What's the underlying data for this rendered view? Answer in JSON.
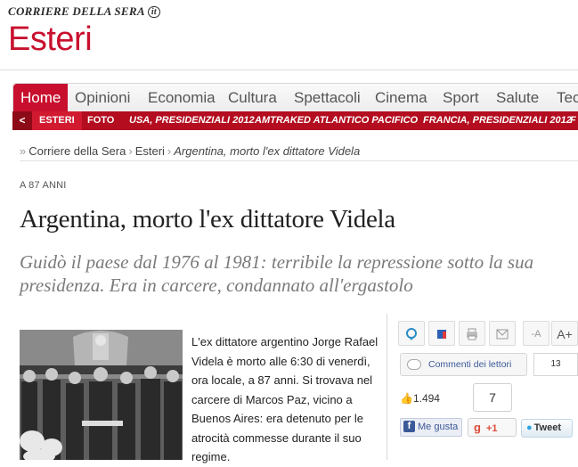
{
  "masthead": {
    "logo_text": "CORRIERE DELLA SERA",
    "logo_mark": "it",
    "section": "Esteri"
  },
  "nav": {
    "items": [
      "Home",
      "Opinioni",
      "Economia",
      "Cultura",
      "Spettacoli",
      "Cinema",
      "Sport",
      "Salute",
      "Tecn"
    ],
    "active": "Home"
  },
  "subnav": {
    "arrow": "<",
    "items": [
      "ESTERI",
      "FOTO",
      "USA, PRESIDENZIALI 2012",
      "AMTRAKED ATLANTICO PACIFICO",
      "FRANCIA, PRESIDENZIALI 2012",
      "F"
    ]
  },
  "breadcrumb": {
    "prefix": "»",
    "items": [
      "Corriere della Sera",
      "Esteri",
      "Argentina, morto l'ex dittatore Videla"
    ],
    "separator": "›"
  },
  "article": {
    "kicker": "A 87 ANNI",
    "headline": "Argentina, morto l'ex dittatore Videla",
    "subheadline": "Guidò il paese dal 1976 al 1981: terribile la repressione sotto la sua presidenza. Era in carcere, condannato all'ergastolo",
    "body": "L'ex dittatore argentino Jorge Rafael Videla è morto alle 6:30 di venerdì, ora locale, a 87 anni. Si trovava nel carcere di Marcos Paz, vicino a Buenos Aires: era detenuto per le atrocità commesse durante il suo regime."
  },
  "social": {
    "tools": {
      "decrease_font": "-A",
      "increase_font": "A+"
    },
    "comments_label": "Commenti dei lettori",
    "comments_count": "13",
    "fb_count": "1.494",
    "gplus_count": "7",
    "fb_like_label": "Me gusta",
    "gplus_label": "+1",
    "tweet_label": "Tweet"
  },
  "colors": {
    "brand_red": "#c8102e",
    "subnav_red": "#b30d1f",
    "facebook_blue": "#3b5998",
    "twitter_blue": "#2ea4de"
  }
}
